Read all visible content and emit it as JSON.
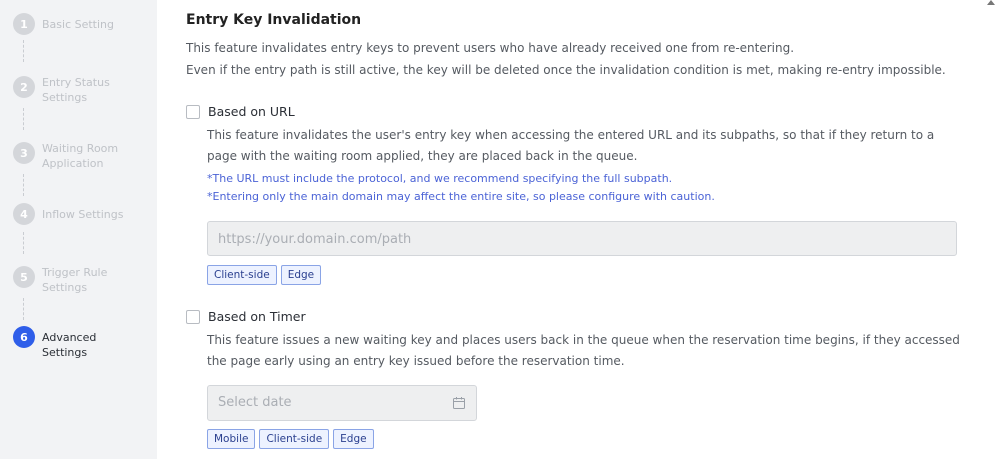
{
  "sidebar": {
    "steps": [
      {
        "num": "1",
        "label": "Basic Setting"
      },
      {
        "num": "2",
        "label": "Entry Status Settings"
      },
      {
        "num": "3",
        "label": "Waiting Room Application"
      },
      {
        "num": "4",
        "label": "Inflow Settings"
      },
      {
        "num": "5",
        "label": "Trigger Rule Settings"
      },
      {
        "num": "6",
        "label": "Advanced Settings"
      }
    ],
    "active_color": "#2f5ee9"
  },
  "section": {
    "title": "Entry Key Invalidation",
    "desc_line1": "This feature invalidates entry keys to prevent users who have already received one from re-entering.",
    "desc_line2": "Even if the entry path is still active, the key will be deleted once the invalidation condition is met, making re-entry impossible."
  },
  "url_option": {
    "label": "Based on URL",
    "checked": false,
    "desc": "This feature invalidates the user's entry key when accessing the entered URL and its subpaths, so that if they return to a page with the waiting room applied, they are placed back in the queue.",
    "note1": "*The URL must include the protocol, and we recommend specifying the full subpath.",
    "note2": "*Entering only the main domain may affect the entire site, so please configure with caution.",
    "placeholder": "https://your.domain.com/path",
    "tags": [
      "Client-side",
      "Edge"
    ]
  },
  "timer_option": {
    "label": "Based on Timer",
    "checked": false,
    "desc": "This feature issues a new waiting key and places users back in the queue when the reservation time begins, if they accessed the page early using an entry key issued before the reservation time.",
    "placeholder": "Select date",
    "tags": [
      "Mobile",
      "Client-side",
      "Edge"
    ]
  },
  "icons": {
    "calendar": "calendar-icon",
    "checkbox": "checkbox-icon",
    "scroll": "scroll-up-icon"
  }
}
